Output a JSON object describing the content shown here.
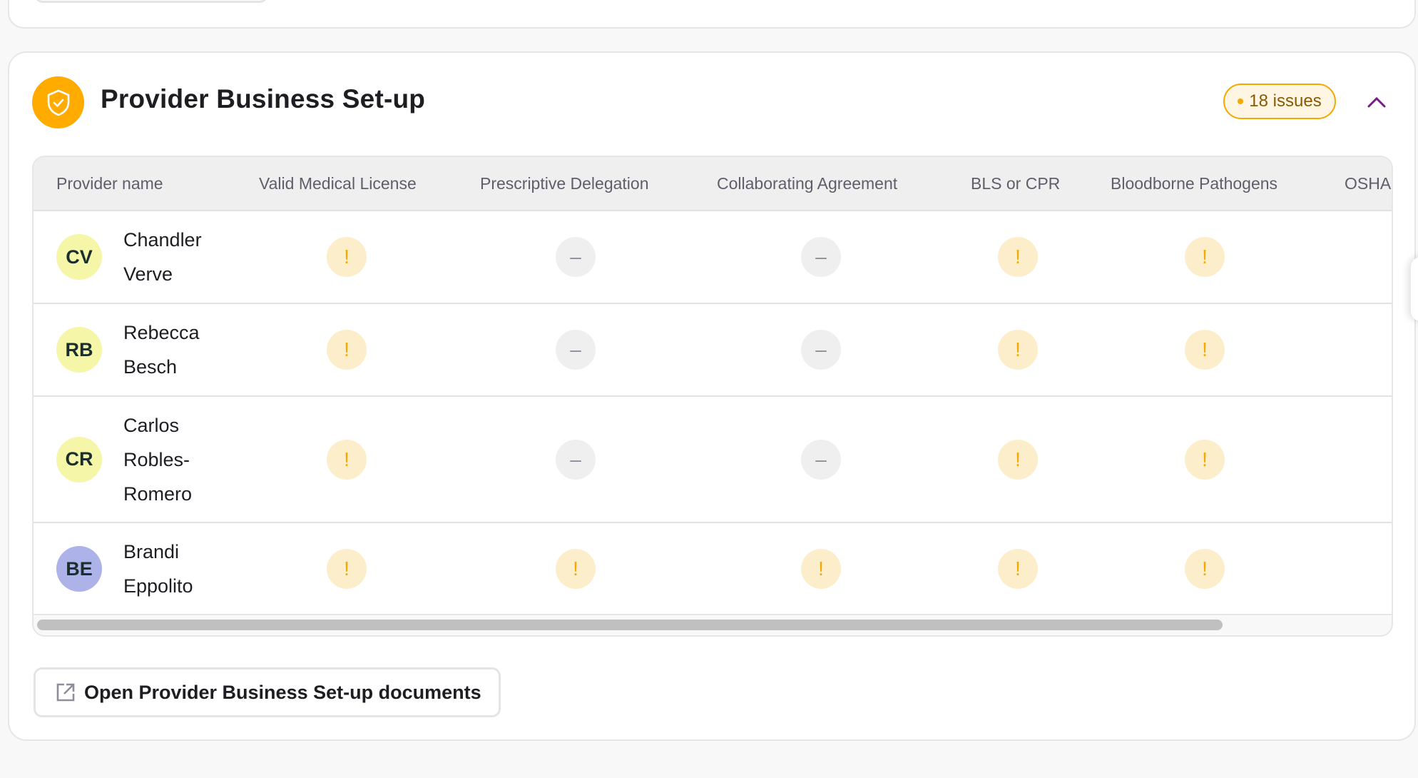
{
  "section": {
    "title": "Provider Business Set-up",
    "icon": "shield-check-icon",
    "issues_badge": "18 issues",
    "collapse_icon": "chevron-up-icon"
  },
  "colors": {
    "accent_orange": "#ffab00",
    "warning": "#f5a800",
    "warning_bg": "#fdeecb",
    "na_bg": "#efefef",
    "chevron": "#7b1a8a"
  },
  "table": {
    "columns": [
      "Provider name",
      "Valid Medical License",
      "Prescriptive Delegation",
      "Collaborating Agreement",
      "BLS or CPR",
      "Bloodborne Pathogens",
      "OSHA"
    ],
    "rows": [
      {
        "initials": "CV",
        "avatar_color": "#f6f6a8",
        "name": "Chandler Verve",
        "statuses": [
          "warning",
          "not-applicable",
          "not-applicable",
          "warning",
          "warning"
        ]
      },
      {
        "initials": "RB",
        "avatar_color": "#f6f6a8",
        "name": "Rebecca Besch",
        "statuses": [
          "warning",
          "not-applicable",
          "not-applicable",
          "warning",
          "warning"
        ]
      },
      {
        "initials": "CR",
        "avatar_color": "#f6f6a8",
        "name": "Carlos Robles-Romero",
        "statuses": [
          "warning",
          "not-applicable",
          "not-applicable",
          "warning",
          "warning"
        ]
      },
      {
        "initials": "BE",
        "avatar_color": "#adb3e8",
        "name": "Brandi Eppolito",
        "statuses": [
          "warning",
          "warning",
          "warning",
          "warning",
          "warning"
        ]
      }
    ],
    "status_glyphs": {
      "warning": "!",
      "not-applicable": "–"
    }
  },
  "footer": {
    "open_docs_label": "Open Provider Business Set-up documents",
    "open_docs_icon": "external-link-icon"
  }
}
